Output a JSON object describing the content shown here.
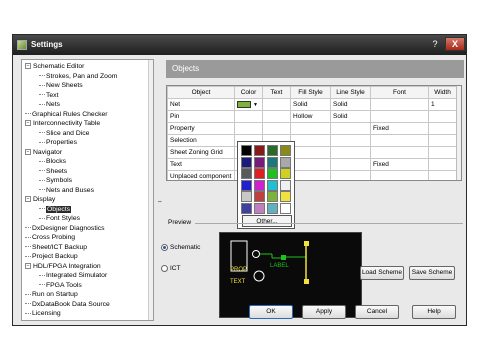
{
  "window": {
    "title": "Settings",
    "help": "?",
    "close": "X"
  },
  "tree": {
    "items": [
      {
        "label": "Schematic Editor",
        "level": 0,
        "expander": "−"
      },
      {
        "label": "Strokes, Pan and Zoom",
        "level": 1
      },
      {
        "label": "New Sheets",
        "level": 1
      },
      {
        "label": "Text",
        "level": 1
      },
      {
        "label": "Nets",
        "level": 1
      },
      {
        "label": "Graphical Rules Checker",
        "level": 0
      },
      {
        "label": "Interconnectivity Table",
        "level": 0,
        "expander": "−"
      },
      {
        "label": "Slice and Dice",
        "level": 1
      },
      {
        "label": "Properties",
        "level": 1
      },
      {
        "label": "Navigator",
        "level": 0,
        "expander": "−"
      },
      {
        "label": "Blocks",
        "level": 1
      },
      {
        "label": "Sheets",
        "level": 1
      },
      {
        "label": "Symbols",
        "level": 1
      },
      {
        "label": "Nets and Buses",
        "level": 1
      },
      {
        "label": "Display",
        "level": 0,
        "expander": "−"
      },
      {
        "label": "Objects",
        "level": 1,
        "selected": true
      },
      {
        "label": "Font Styles",
        "level": 1
      },
      {
        "label": "DxDesigner Diagnostics",
        "level": 0
      },
      {
        "label": "Cross Probing",
        "level": 0
      },
      {
        "label": "Sheet/ICT Backup",
        "level": 0
      },
      {
        "label": "Project Backup",
        "level": 0
      },
      {
        "label": "HDL/FPGA Integration",
        "level": 0,
        "expander": "−"
      },
      {
        "label": "Integrated Simulator",
        "level": 1
      },
      {
        "label": "FPGA Tools",
        "level": 1
      },
      {
        "label": "Run on Startup",
        "level": 0
      },
      {
        "label": "DxDataBook Data Source",
        "level": 0
      },
      {
        "label": "Licensing",
        "level": 0
      }
    ]
  },
  "splitter": {
    "glyph": "⇔"
  },
  "panel": {
    "title": "Objects"
  },
  "table": {
    "columns": [
      "Object",
      "Color",
      "Text",
      "Fill Style",
      "Line Style",
      "Font",
      "Width"
    ],
    "rows": [
      {
        "object": "Net",
        "text": "",
        "fill": "Solid",
        "line": "Solid",
        "font": "",
        "width": "1"
      },
      {
        "object": "Pin",
        "text": "",
        "fill": "Hollow",
        "line": "Solid",
        "font": "",
        "width": ""
      },
      {
        "object": "Property",
        "text": "",
        "fill": "",
        "line": "",
        "font": "Fixed",
        "width": ""
      },
      {
        "object": "Selection",
        "text": "",
        "fill": "",
        "line": "",
        "font": "",
        "width": ""
      },
      {
        "object": "Sheet Zoning Grid",
        "text": "",
        "fill": "",
        "line": "",
        "font": "",
        "width": ""
      },
      {
        "object": "Text",
        "text": "",
        "fill": "",
        "line": "",
        "font": "Fixed",
        "width": ""
      },
      {
        "object": "Unplaced component",
        "text": "",
        "fill": "",
        "line": "",
        "font": "",
        "width": ""
      }
    ],
    "net_color": "#7cb33a",
    "dropdown_glyph": "▼"
  },
  "palette": {
    "colors": [
      "#000000",
      "#8a1a1a",
      "#2a6a2a",
      "#8a8a1a",
      "#1a1a7a",
      "#7a1a7a",
      "#1a7a7a",
      "#a8a8a8",
      "#5a5a5a",
      "#e02020",
      "#20c020",
      "#d0d020",
      "#2020d0",
      "#d020d0",
      "#20c0d0",
      "#f0f0f0",
      "#c8c8c8",
      "#c04040",
      "#7cb33a",
      "#f0e040",
      "#4040a0",
      "#c080c0",
      "#60b0c0",
      "#ffffff"
    ],
    "other_label": "Other..."
  },
  "preview": {
    "section_label": "Preview",
    "radio_schematic": "Schematic",
    "radio_ict": "ICT",
    "selected": "Schematic",
    "labels": {
      "prop": "PROP",
      "text": "TEXT",
      "label": "LABEL"
    },
    "colors": {
      "bg": "#0a0a0a",
      "box": "#ffffff",
      "net": "#20c020",
      "prop": "#f0e040",
      "pin": "#f0e040"
    }
  },
  "buttons": {
    "load_scheme": "Load Scheme",
    "save_scheme": "Save Scheme",
    "ok": "OK",
    "apply": "Apply",
    "cancel": "Cancel",
    "help": "Help"
  }
}
